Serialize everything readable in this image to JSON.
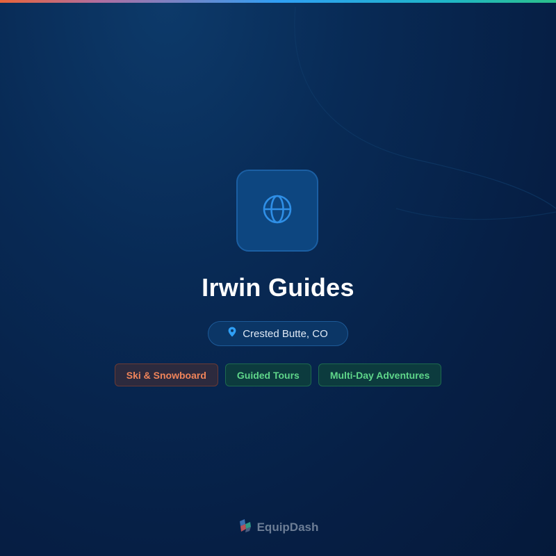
{
  "colors": {
    "accent_blue": "#2f9ff5",
    "tag_orange": "#f0845a",
    "tag_green": "#5fd68a"
  },
  "card": {
    "logo_icon": "globe-icon",
    "title": "Irwin Guides",
    "location": {
      "icon": "map-pin-icon",
      "text": "Crested Butte, CO"
    },
    "tags": [
      {
        "label": "Ski & Snowboard"
      },
      {
        "label": "Guided Tours"
      },
      {
        "label": "Multi-Day Adventures"
      }
    ]
  },
  "footer": {
    "brand_icon": "equipdash-logo-icon",
    "brand_name": "EquipDash"
  }
}
